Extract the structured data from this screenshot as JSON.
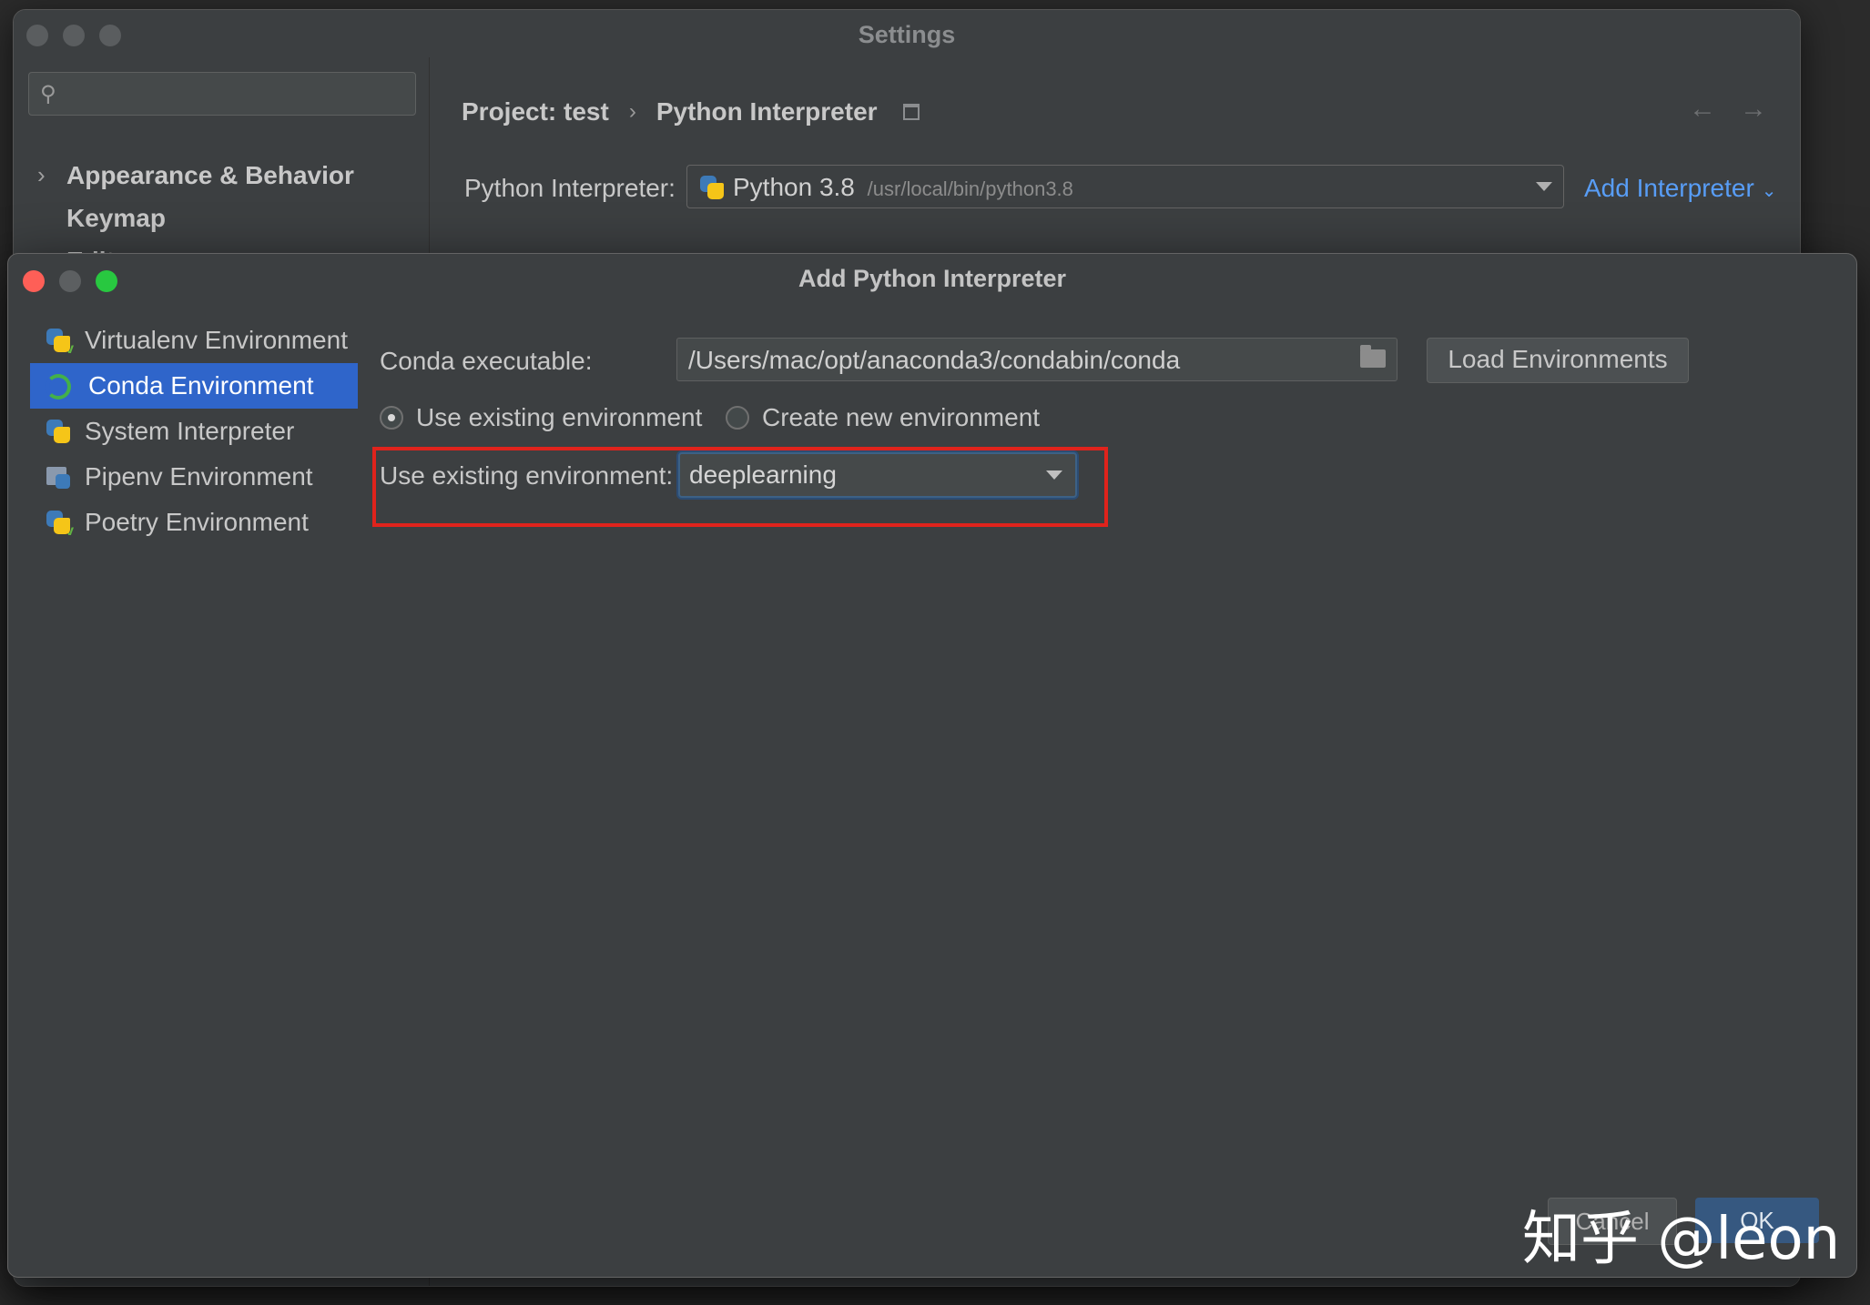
{
  "settings": {
    "title": "Settings",
    "sidebar": {
      "items": [
        {
          "label": "Appearance & Behavior",
          "expandable": true
        },
        {
          "label": "Keymap",
          "expandable": false
        },
        {
          "label": "Editor",
          "expandable": true
        }
      ]
    },
    "breadcrumb": {
      "project": "Project: test",
      "page": "Python Interpreter"
    },
    "interpreter": {
      "label": "Python Interpreter:",
      "version": "Python 3.8",
      "path": "/usr/local/bin/python3.8",
      "add_label": "Add Interpreter"
    }
  },
  "dialog": {
    "title": "Add Python Interpreter",
    "environments": [
      {
        "label": "Virtualenv Environment",
        "icon": "virtualenv-icon",
        "selected": false
      },
      {
        "label": "Conda Environment",
        "icon": "conda-icon",
        "selected": true
      },
      {
        "label": "System Interpreter",
        "icon": "python-icon",
        "selected": false
      },
      {
        "label": "Pipenv Environment",
        "icon": "pipenv-icon",
        "selected": false
      },
      {
        "label": "Poetry Environment",
        "icon": "poetry-icon",
        "selected": false
      }
    ],
    "conda_executable_label": "Conda executable:",
    "conda_executable_value": "/Users/mac/opt/anaconda3/condabin/conda",
    "load_button": "Load Environments",
    "radio_existing": "Use existing environment",
    "radio_new": "Create new environment",
    "existing_env_label": "Use existing environment:",
    "existing_env_value": "deeplearning",
    "cancel_button": "Cancel",
    "ok_button": "OK"
  },
  "watermark": "知乎 @leon",
  "colors": {
    "selection": "#2f65ca",
    "link": "#589df6",
    "highlight": "#e0231c"
  }
}
